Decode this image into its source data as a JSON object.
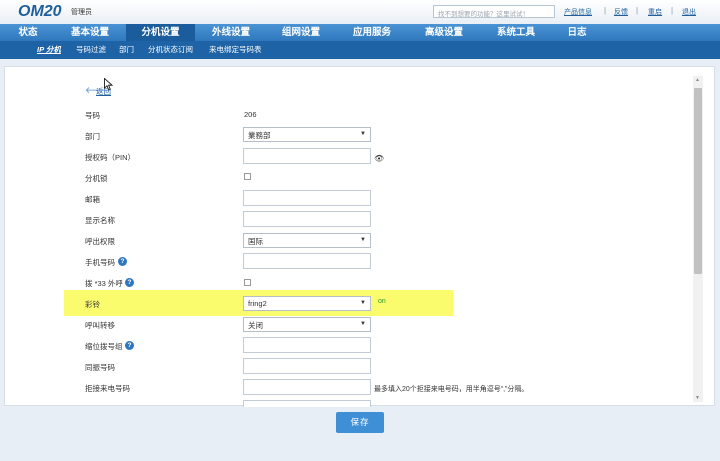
{
  "header": {
    "logo": "OM20",
    "role": "管理员",
    "search_placeholder": "找不到想要的功能？这里试试！",
    "links": [
      "产品信息",
      "反馈",
      "重启",
      "退出"
    ]
  },
  "main_nav": [
    "状态",
    "基本设置",
    "分机设置",
    "外线设置",
    "组网设置",
    "应用服务",
    "高级设置",
    "系统工具",
    "日志"
  ],
  "sub_nav": [
    "IP 分机",
    "号码过滤",
    "部门",
    "分机状态订阅",
    "来电绑定号码表"
  ],
  "back_label": "返回",
  "form": {
    "number": {
      "label": "号码",
      "value": "206"
    },
    "department": {
      "label": "部门",
      "value": "業務部"
    },
    "pin": {
      "label": "授权码（PIN）",
      "value": ""
    },
    "extension_lock": {
      "label": "分机锁"
    },
    "email": {
      "label": "邮箱",
      "value": ""
    },
    "display_name": {
      "label": "显示名称",
      "value": ""
    },
    "call_permission": {
      "label": "呼出权限",
      "value": "国际"
    },
    "mobile": {
      "label": "手机号码",
      "value": ""
    },
    "dial33": {
      "label": "拨 *33 外呼"
    },
    "ringback": {
      "label": "彩铃",
      "value": "fring2"
    },
    "call_forward": {
      "label": "呼叫转移",
      "value": "关闭"
    },
    "short_code": {
      "label": "缩位拨号组",
      "value": ""
    },
    "simul_ring": {
      "label": "同振号码",
      "value": ""
    },
    "reject_numbers": {
      "label": "拒接来电号码",
      "value": "",
      "hint": "最多填入20个拒接来电号码，用半角逗号“,”分隔。"
    }
  },
  "save_label": "保存",
  "ringback_status": "on"
}
